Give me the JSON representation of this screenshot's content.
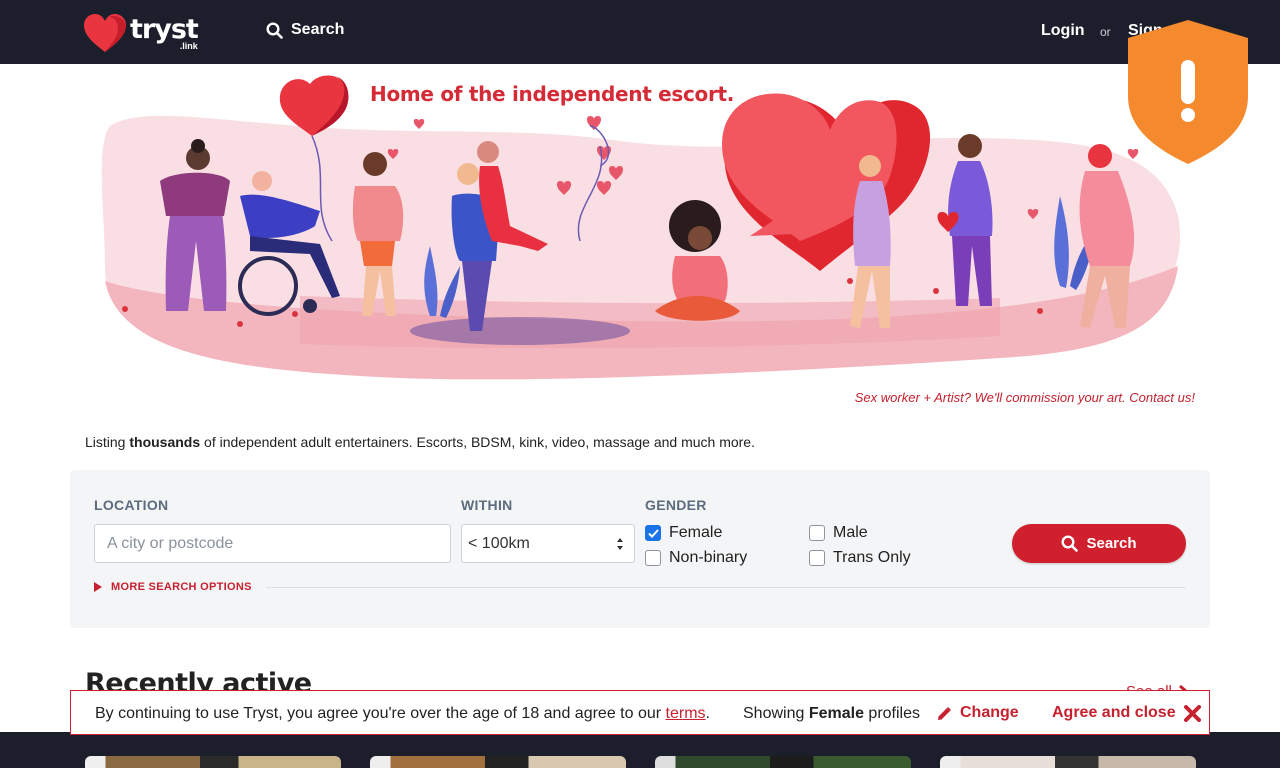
{
  "header": {
    "logo_text": "tryst",
    "logo_sub": ".link",
    "search_label": "Search",
    "login_label": "Login",
    "or_label": "or",
    "signup_label": "Sign up"
  },
  "hero": {
    "title": "Home of the independent escort.",
    "commission_link": "Sex worker + Artist? We'll commission your art. Contact us!"
  },
  "listing": {
    "prefix": "Listing ",
    "bold": "thousands",
    "suffix": " of independent adult entertainers. Escorts, BDSM, kink, video, massage and much more."
  },
  "search": {
    "location_label": "LOCATION",
    "location_placeholder": "A city or postcode",
    "location_value": "",
    "within_label": "WITHIN",
    "within_value": "< 100km",
    "gender_label": "GENDER",
    "genders": [
      {
        "label": "Female",
        "checked": true
      },
      {
        "label": "Male",
        "checked": false
      },
      {
        "label": "Non-binary",
        "checked": false
      },
      {
        "label": "Trans Only",
        "checked": false
      }
    ],
    "button_label": "Search",
    "more_options": "MORE SEARCH OPTIONS"
  },
  "recent": {
    "heading": "Recently active",
    "see_all": "See all"
  },
  "consent": {
    "text_before": "By continuing to use Tryst, you agree you're over the age of 18 and agree to our ",
    "terms": "terms",
    "text_after": ".",
    "showing_prefix": "Showing ",
    "showing_bold": "Female",
    "showing_suffix": " profiles",
    "change_label": "Change",
    "agree_label": "Agree and close"
  },
  "colors": {
    "brand_red": "#d01f2d",
    "dark_bar": "#1c1f2b",
    "shield_orange": "#f5892e",
    "checkbox_blue": "#1a73e8"
  },
  "icons": [
    "heart-logo-icon",
    "search-icon",
    "shield-alert-icon",
    "select-arrows-icon",
    "checkmark-icon",
    "caret-right-icon",
    "pencil-icon",
    "close-x-icon",
    "chevron-right-icon"
  ]
}
